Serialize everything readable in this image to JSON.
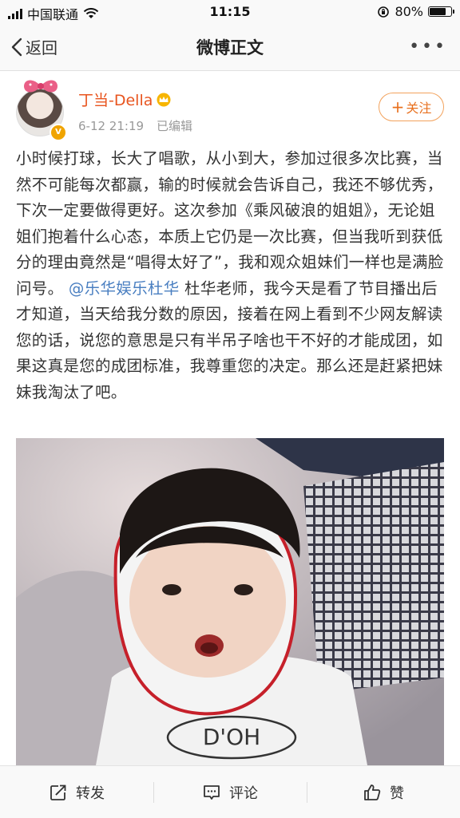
{
  "status_bar": {
    "carrier": "中国联通",
    "time": "11:15",
    "battery": "80%",
    "battery_level": 0.8
  },
  "nav": {
    "back_label": "返回",
    "title": "微博正文"
  },
  "post": {
    "author": "丁当-Della",
    "date": "6-12 21:19",
    "edited": "已编辑",
    "follow_label": "关注",
    "text_before_mention": "小时候打球，长大了唱歌，从小到大，参加过很多次比赛，当然不可能每次都赢，输的时候就会告诉自己，我还不够优秀，下次一定要做得更好。这次参加《乘风破浪的姐姐》，无论姐姐们抱着什么心态，本质上它仍是一次比赛，但当我听到获低分的理由竟然是“唱得太好了”，我和观众姐妹们一样也是满脸问号。",
    "mention": "@乐华娱乐杜华",
    "text_after_mention": " 杜华老师，我今天是看了节目播出后才知道，当天给我分数的原因，接着在网上看到不少网友解读您的话，说您的意思是只有半吊子啥也干不好的才能成团，如果这真是您的成团标准，我尊重您的决定。那么还是赶紧把妹妹我淘汰了吧。",
    "photo_shirt_text": "D'OH"
  },
  "actions": {
    "repost": "转发",
    "comment": "评论",
    "like": "赞"
  },
  "colors": {
    "accent_orange": "#e8541e",
    "mention_blue": "#4a7fc1",
    "verified_gold": "#f0a400"
  }
}
